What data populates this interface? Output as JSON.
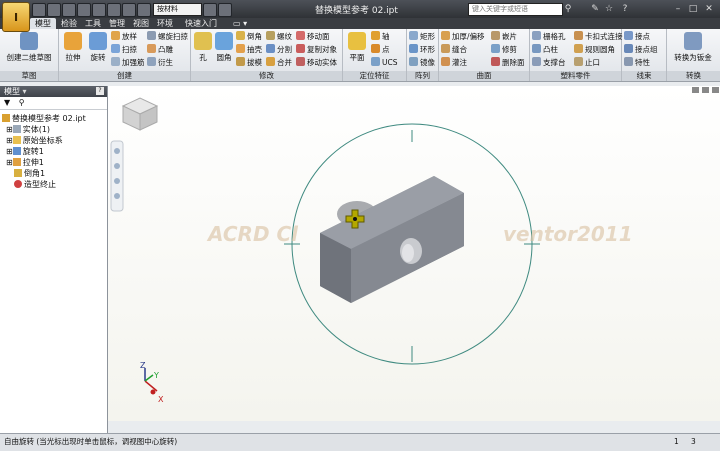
{
  "window": {
    "title": "替换模型参考 02.ipt",
    "doc_selector": "按材料",
    "search_placeholder": "键入关键字或短语"
  },
  "tabs": [
    "模型",
    "检验",
    "工具",
    "管理",
    "视图",
    "环境",
    "快速入门"
  ],
  "ribbon": {
    "sketch": {
      "label": "草图",
      "create_sketch": "创建二维草图"
    },
    "create": {
      "label": "创建",
      "stretch": "拉伸",
      "revolve": "旋转",
      "loft": "放样",
      "sweep": "扫掠",
      "rib": "加强筋",
      "coil": "螺旋扫掠",
      "emboss": "凸雕",
      "derive": "衍生"
    },
    "modify": {
      "label": "修改",
      "hole": "孔",
      "fillet": "圆角",
      "chamfer": "倒角",
      "shell": "抽壳",
      "draft": "拔模",
      "thread": "螺纹",
      "split": "分割",
      "combine": "合并",
      "move_face": "移动面",
      "copy_object": "复制对象",
      "move_body": "移动实体"
    },
    "work": {
      "label": "定位特征",
      "plane": "平面",
      "axis": "轴",
      "point": "点",
      "ucs": "UCS"
    },
    "pattern": {
      "label": "阵列",
      "rect": "矩形",
      "circular": "环形",
      "mirror": "镜像"
    },
    "surface": {
      "label": "曲面",
      "thicken": "加厚/偏移",
      "stitch": "缝合",
      "sculpt": "灌注",
      "patch": "嵌片",
      "trim": "修剪",
      "delete_face": "删除面"
    },
    "plastic": {
      "label": "塑料零件",
      "grill": "栅格孔",
      "boss": "凸柱",
      "rest": "支撑台",
      "snap_fit": "卡扣式连接",
      "rule_fillet": "规则圆角",
      "lip": "止口"
    },
    "harness": {
      "label": "线束",
      "connector": "接点",
      "connector_group": "接点组",
      "property": "特性"
    },
    "convert": {
      "label": "转换",
      "to_sheet_metal": "转换为钣金"
    }
  },
  "browser": {
    "title": "模型",
    "items": [
      {
        "label": "替换模型参考 02.ipt",
        "icon": "part-icon"
      },
      {
        "label": "实体(1)",
        "icon": "solid-bodies-icon"
      },
      {
        "label": "原始坐标系",
        "icon": "folder-icon"
      },
      {
        "label": "旋转1",
        "icon": "revolve-icon"
      },
      {
        "label": "拉伸1",
        "icon": "extrude-icon"
      },
      {
        "label": "倒角1",
        "icon": "chamfer-icon"
      },
      {
        "label": "造型终止",
        "icon": "end-of-part-icon"
      }
    ]
  },
  "viewport": {
    "watermark": "ACRD Cl",
    "watermark2": "ventor2011",
    "axis_x": "X",
    "axis_y": "Y",
    "axis_z": "Z"
  },
  "status": {
    "hint": "自由旋转 (当光标出现时单击鼠标，调视图中心旋转)",
    "count1": "1",
    "count2": "3"
  },
  "colors": {
    "ribbon_top": "#f6f7f9",
    "titlebar": "#3a3d42",
    "model": "#7c8088",
    "orbit": "#3f8a80"
  }
}
